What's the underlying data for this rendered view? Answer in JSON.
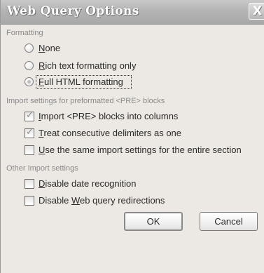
{
  "window": {
    "title": "Web Query Options",
    "close_glyph": "X"
  },
  "formatting": {
    "group_label": "Formatting",
    "options": [
      {
        "pre": "",
        "key": "N",
        "post": "one",
        "selected": false
      },
      {
        "pre": "",
        "key": "R",
        "post": "ich text formatting only",
        "selected": false
      },
      {
        "pre": "",
        "key": "F",
        "post": "ull HTML formatting",
        "selected": true
      }
    ]
  },
  "pre_import": {
    "group_label": "Import settings for preformatted <PRE> blocks",
    "options": [
      {
        "pre": "",
        "key": "I",
        "post": "mport <PRE> blocks into columns",
        "checked": true
      },
      {
        "pre": "",
        "key": "T",
        "post": "reat consecutive delimiters as one",
        "checked": true
      },
      {
        "pre": "",
        "key": "U",
        "post": "se the same import settings for the entire section",
        "checked": false
      }
    ]
  },
  "other_import": {
    "group_label": "Other Import settings",
    "options": [
      {
        "pre": "",
        "key": "D",
        "post": "isable date recognition",
        "checked": false
      },
      {
        "pre": "Disable ",
        "key": "W",
        "post": "eb query redirections",
        "checked": false
      }
    ]
  },
  "buttons": {
    "ok_label": "OK",
    "cancel_label": "Cancel"
  },
  "colors": {
    "dialog_bg": "#ece9e4",
    "titlebar": "#b4b4b4",
    "title_text": "#ffffff",
    "group_label": "#8a8a8a"
  }
}
